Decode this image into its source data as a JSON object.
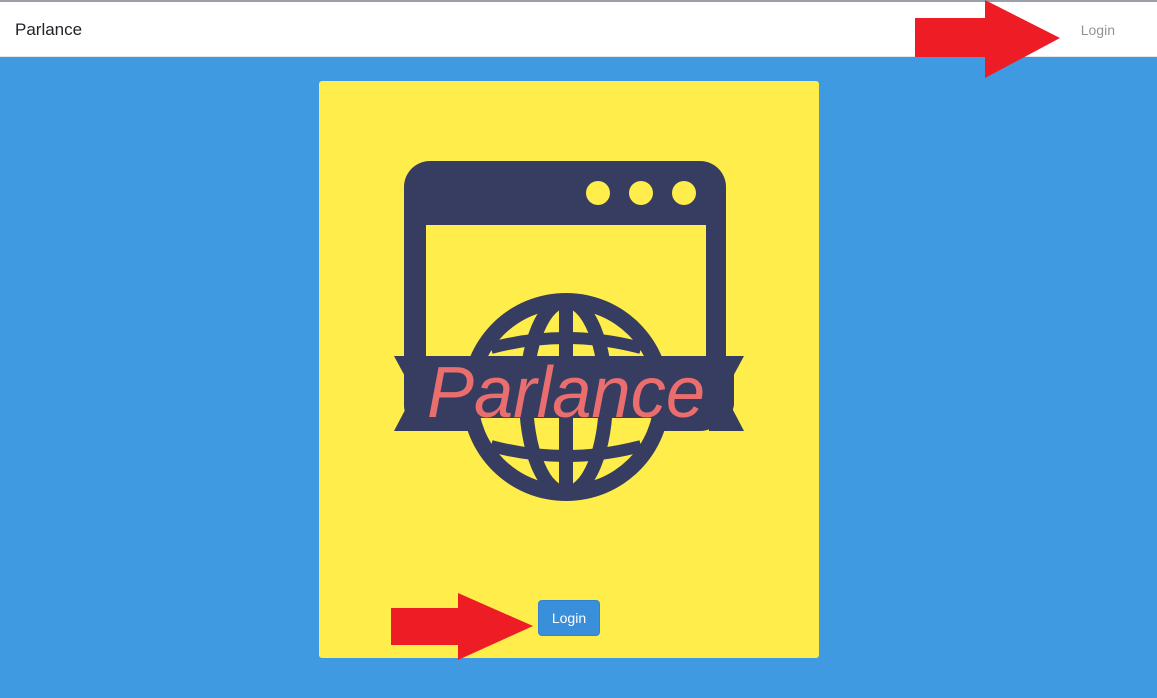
{
  "navbar": {
    "brand": "Parlance",
    "login_link": "Login"
  },
  "card": {
    "logo_text": "Parlance",
    "login_button": "Login"
  },
  "colors": {
    "page_background": "#3f9ae2",
    "card_background": "#feed4a",
    "logo_navy": "#363d60",
    "logo_text": "#eb6e6e",
    "button": "#3a8fdb",
    "annotation_arrow": "#ee1c24"
  },
  "icons": {
    "logo": "browser-window-globe-logo",
    "annotation": "red-arrow-icon"
  }
}
